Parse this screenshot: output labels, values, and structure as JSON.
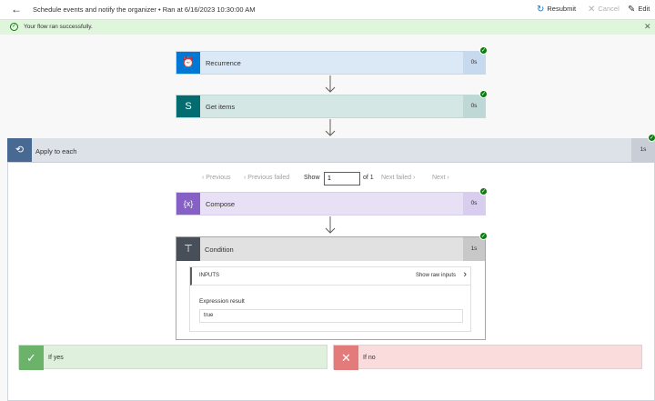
{
  "header": {
    "title": "Schedule events and notify the organizer • Ran at 6/16/2023 10:30:00 AM",
    "resubmit": "Resubmit",
    "cancel": "Cancel",
    "edit": "Edit"
  },
  "banner": {
    "message": "Your flow ran successfully."
  },
  "steps": {
    "recurrence": {
      "label": "Recurrence",
      "duration": "0s",
      "color": "#0078d4"
    },
    "get_items": {
      "label": "Get items",
      "duration": "0s",
      "color": "#036c70"
    },
    "apply_to_each": {
      "label": "Apply to each",
      "duration": "1s",
      "color": "#486991"
    },
    "compose": {
      "label": "Compose",
      "duration": "0s",
      "color": "#8661c5"
    },
    "condition": {
      "label": "Condition",
      "duration": "1s"
    }
  },
  "pager": {
    "previous": "Previous",
    "previous_failed": "Previous failed",
    "show": "Show",
    "value": "1",
    "of": "of 1",
    "next_failed": "Next failed",
    "next": "Next"
  },
  "condition_inputs": {
    "header": "INPUTS",
    "show_raw": "Show raw inputs",
    "expression_label": "Expression result",
    "expression_value": "true"
  },
  "branches": {
    "yes": "If yes",
    "no": "If no"
  }
}
